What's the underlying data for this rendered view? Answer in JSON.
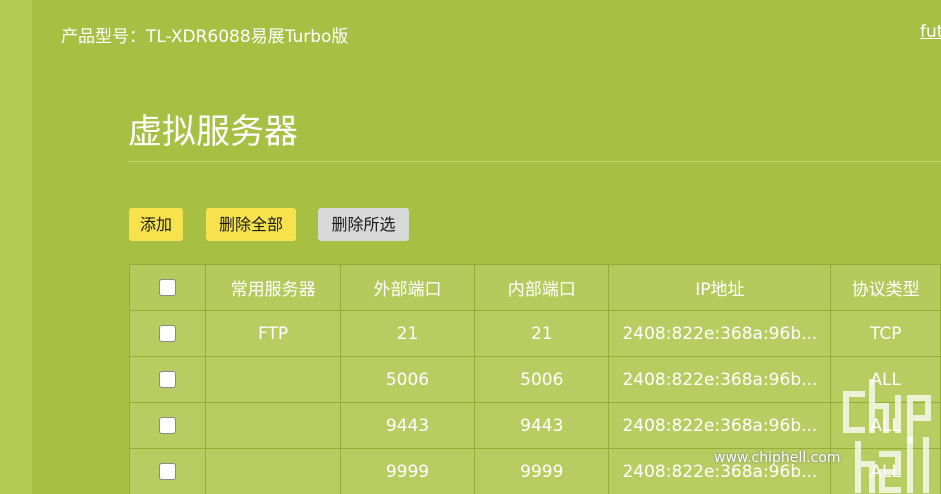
{
  "header": {
    "model_label": "产品型号：TL-XDR6088易展Turbo版",
    "user_link": "fut"
  },
  "page": {
    "title": "虚拟服务器"
  },
  "toolbar": {
    "add_label": "添加",
    "delete_all_label": "删除全部",
    "delete_selected_label": "删除所选"
  },
  "table": {
    "columns": [
      "常用服务器",
      "外部端口",
      "内部端口",
      "IP地址",
      "协议类型"
    ],
    "rows": [
      {
        "service": "FTP",
        "external_port": "21",
        "internal_port": "21",
        "ip": "2408:822e:368a:96b...",
        "protocol": "TCP"
      },
      {
        "service": "",
        "external_port": "5006",
        "internal_port": "5006",
        "ip": "2408:822e:368a:96b...",
        "protocol": "ALL"
      },
      {
        "service": "",
        "external_port": "9443",
        "internal_port": "9443",
        "ip": "2408:822e:368a:96b...",
        "protocol": "ALL"
      },
      {
        "service": "",
        "external_port": "9999",
        "internal_port": "9999",
        "ip": "2408:822e:368a:96b...",
        "protocol": "ALL"
      }
    ]
  },
  "watermark": {
    "url": "www.chiphell.com"
  }
}
